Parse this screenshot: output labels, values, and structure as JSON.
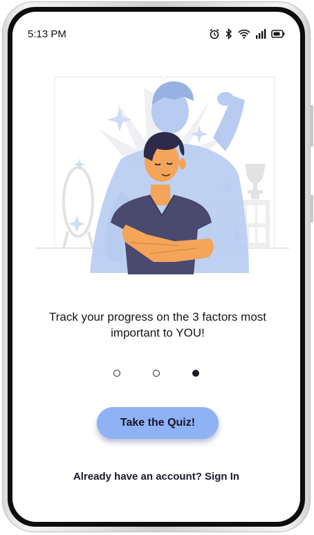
{
  "status_bar": {
    "time": "5:13 PM",
    "icons": [
      "alarm-icon",
      "bluetooth-icon",
      "wifi-icon",
      "signal-icon",
      "battery-icon"
    ]
  },
  "onboarding": {
    "headline": "Track your progress on the 3 factors most important to YOU!",
    "page_count": 3,
    "active_page": 3
  },
  "quiz_button": {
    "label": "Take the Quiz!"
  },
  "signin_link": {
    "label": "Already have an account? Sign In"
  },
  "colors": {
    "accent": "#8fb2f5",
    "hero_shadow": "#b8ccf2",
    "shirt": "#4a4a6e",
    "skin": "#f4a55a",
    "hair": "#2d2a4a"
  }
}
